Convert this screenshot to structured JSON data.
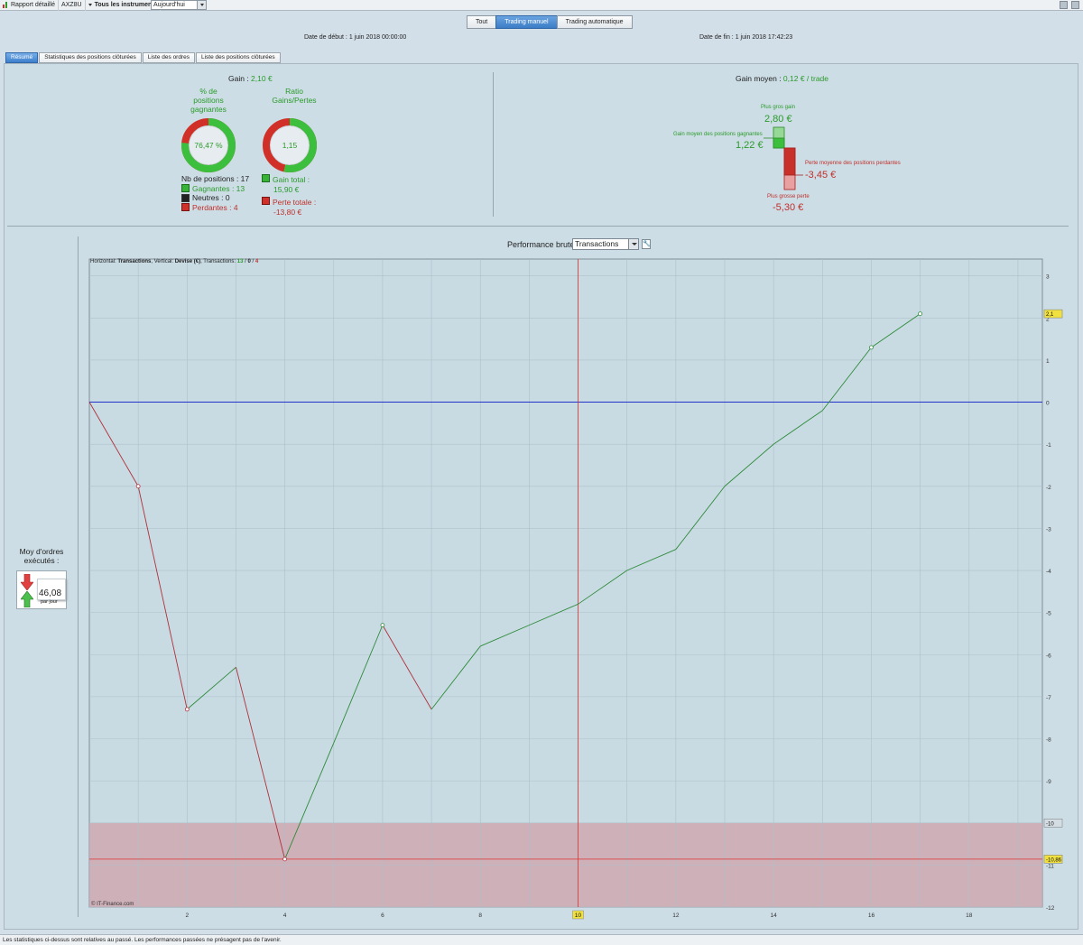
{
  "toolbar": {
    "report_label": "Rapport détaillé",
    "instrument": "AXZ8U",
    "scope_label": "Tous les instruments",
    "period_value": "Aujourd'hui"
  },
  "mode_tabs": [
    {
      "label": "Tout",
      "active": false
    },
    {
      "label": "Trading manuel",
      "active": true
    },
    {
      "label": "Trading automatique",
      "active": false
    }
  ],
  "dates": {
    "start": "Date de début : 1 juin 2018 00:00:00",
    "end": "Date de fin : 1 juin 2018 17:42:23"
  },
  "sub_tabs": [
    {
      "label": "Résumé",
      "active": true
    },
    {
      "label": "Statistiques des positions clôturées",
      "active": false
    },
    {
      "label": "Liste des ordres",
      "active": false
    },
    {
      "label": "Liste des positions clôturées",
      "active": false
    }
  ],
  "summary": {
    "gain_label": "Gain : ",
    "gain_value": "2,10 €",
    "win_pct_label_1": "% de",
    "win_pct_label_2": "positions",
    "win_pct_label_3": "gagnantes",
    "win_pct_value": "76,47 %",
    "win_fraction": 0.7647,
    "ratio_label_1": "Ratio",
    "ratio_label_2": "Gains/Pertes",
    "ratio_value": "1,15",
    "ratio_gain_share": 0.535,
    "nb_positions": "Nb de positions : 17",
    "winning": "Gagnantes : 13",
    "neutral": "Neutres : 0",
    "losing": "Perdantes : 4",
    "total_gain_label": "Gain total :",
    "total_gain_value": "15,90 €",
    "total_loss_label": "Perte totale :",
    "total_loss_value": "-13,80 €"
  },
  "avg_gain": {
    "label": "Gain moyen : ",
    "value": "0,12 € / trade",
    "biggest_gain_label": "Plus gros gain",
    "biggest_gain_value": "2,80 €",
    "avg_win_label": "Gain moyen des positions gagnantes",
    "avg_win_value": "1,22 €",
    "avg_loss_label": "Perte moyenne des positions perdantes",
    "avg_loss_value": "-3,45 €",
    "biggest_loss_label": "Plus grosse perte",
    "biggest_loss_value": "-5,30 €"
  },
  "orders": {
    "label_1": "Moy d'ordres",
    "label_2": "exécutés :",
    "value": "46,08",
    "unit": "par jour"
  },
  "performance": {
    "title": "Performance brute",
    "select_value": "Transactions",
    "legend_prefix": "Horizontal: ",
    "legend_h": "Transactions",
    "legend_mid": ", Vertical: ",
    "legend_v": "Devise (€)",
    "legend_tx": ", Transactions: ",
    "legend_win": "13",
    "legend_sep1": " / ",
    "legend_neutral": "0",
    "legend_sep2": " / ",
    "legend_loss": "4",
    "copyright": "© IT-Finance.com"
  },
  "chart_data": {
    "type": "line",
    "title": "Performance brute",
    "xlabel": "Transactions",
    "ylabel": "Devise (€)",
    "xlim": [
      0,
      19.5
    ],
    "ylim": [
      -12,
      3.4
    ],
    "x_ticks": [
      2,
      4,
      6,
      8,
      10,
      12,
      14,
      16,
      18
    ],
    "y_ticks": [
      3,
      2,
      1,
      0,
      -1,
      -2,
      -3,
      -4,
      -5,
      -6,
      -7,
      -8,
      -9,
      -10,
      -11,
      -12
    ],
    "x": [
      0,
      1,
      2,
      3,
      4,
      5,
      6,
      7,
      8,
      9,
      10,
      11,
      12,
      13,
      14,
      15,
      16,
      17
    ],
    "y": [
      0,
      -2.0,
      -7.3,
      -6.3,
      -10.86,
      -8.1,
      -5.3,
      -7.3,
      -5.8,
      -5.3,
      -4.8,
      -4.0,
      -3.5,
      -2.0,
      -1.0,
      -0.2,
      1.3,
      2.1
    ],
    "markers_x": [
      1,
      2,
      4,
      6,
      16,
      17
    ],
    "last_value_label": "2,1",
    "min_value_label": "-10,86",
    "loss_zone_top_label": "-10",
    "cursor_x": 10,
    "cursor_label": "10",
    "grid": true,
    "colors": {
      "gain": "#2f8a3a",
      "loss": "#b0303a",
      "zero": "#2233cc",
      "cursor": "#e03030",
      "zone": "#cfa8b2"
    }
  },
  "footer": "Les statistiques ci-dessus sont relatives au passé. Les performances passées ne présagent pas de l'avenir."
}
